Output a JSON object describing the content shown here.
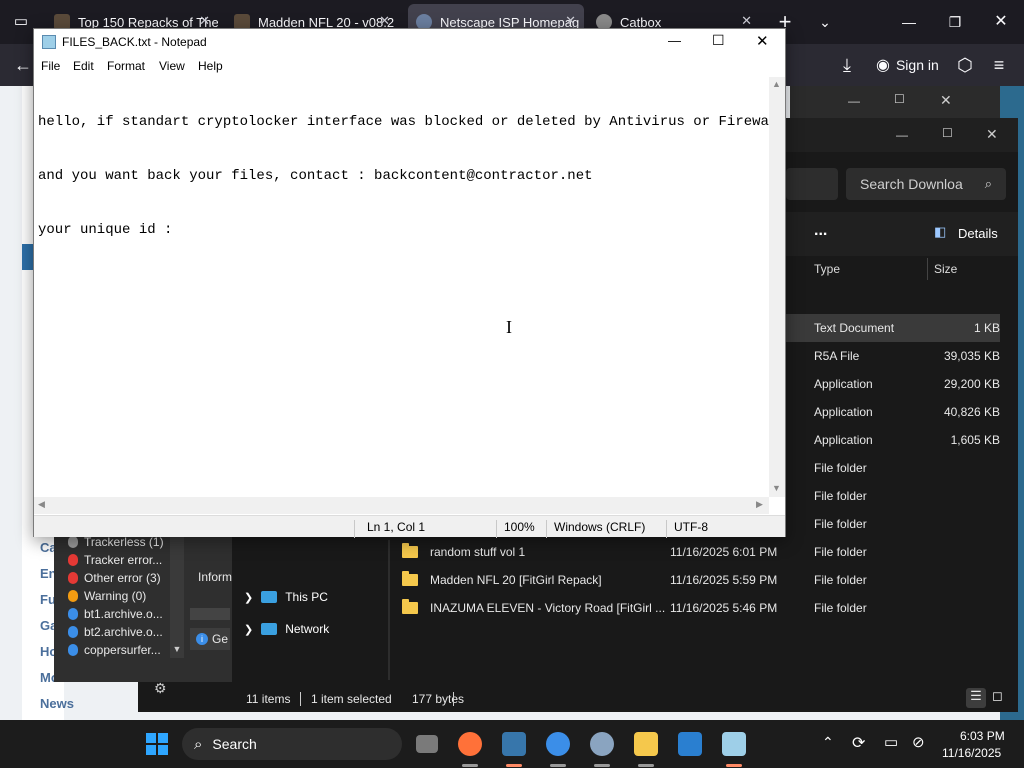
{
  "browser": {
    "tabs": [
      {
        "title": "Top 150 Repacks of The",
        "active": false
      },
      {
        "title": "Madden NFL 20 - v08.2",
        "active": false
      },
      {
        "title": "Netscape ISP Homepag",
        "active": true
      },
      {
        "title": "Catbox",
        "active": false
      }
    ],
    "new_tab": "+",
    "sign_in": "Sign in"
  },
  "website": {
    "side_items": [
      "Ca",
      "En",
      "Fu",
      "Ga",
      "Ho",
      "Mo",
      "News"
    ]
  },
  "notepad": {
    "title": "FILES_BACK.txt - Notepad",
    "menu": [
      "File",
      "Edit",
      "Format",
      "View",
      "Help"
    ],
    "content_lines": [
      "hello, if standart cryptolocker interface was blocked or deleted by Antivirus or Firewall",
      "and you want back your files, contact : backcontent@contractor.net",
      "your unique id :"
    ],
    "status": {
      "position": "Ln 1, Col 1",
      "zoom": "100%",
      "line_ending": "Windows (CRLF)",
      "encoding": "UTF-8"
    }
  },
  "explorer": {
    "search_placeholder": "Search Downloa",
    "more": "...",
    "details_label": "Details",
    "columns": {
      "type": "Type",
      "size": "Size"
    },
    "rows": [
      {
        "type": "Text Document",
        "size": "1 KB",
        "selected": true
      },
      {
        "type": "R5A File",
        "size": "39,035 KB"
      },
      {
        "type": "Application",
        "size": "29,200 KB"
      },
      {
        "type": "Application",
        "size": "40,826 KB"
      },
      {
        "type": "Application",
        "size": "1,605 KB"
      },
      {
        "type": "File folder",
        "size": ""
      },
      {
        "type": "File folder",
        "size": ""
      },
      {
        "type": "File folder",
        "size": ""
      }
    ],
    "folders": [
      {
        "name": "random stuff vol 1",
        "date": "11/16/2025 6:01 PM",
        "type": "File folder"
      },
      {
        "name": "Madden NFL 20 [FitGirl Repack]",
        "date": "11/16/2025 5:59 PM",
        "type": "File folder"
      },
      {
        "name": "INAZUMA ELEVEN - Victory Road [FitGirl ...",
        "date": "11/16/2025 5:46 PM",
        "type": "File folder"
      }
    ],
    "nav": [
      "This PC",
      "Network"
    ],
    "status": {
      "items": "11 items",
      "selected": "1 item selected",
      "bytes": "177 bytes"
    }
  },
  "qbittorrent": {
    "filters": [
      {
        "label": "Trackerless (1)",
        "color": "#9a9a9a"
      },
      {
        "label": "Tracker error...",
        "color": "#e53935"
      },
      {
        "label": "Other error (3)",
        "color": "#e53935"
      },
      {
        "label": "Warning (0)",
        "color": "#f39c12"
      },
      {
        "label": "bt1.archive.o...",
        "color": "#3b8ee8"
      },
      {
        "label": "bt2.archive.o...",
        "color": "#3b8ee8"
      },
      {
        "label": "coppersurfer...",
        "color": "#3b8ee8"
      }
    ],
    "info_label": "Inform",
    "general_label": "Ge"
  },
  "taskbar": {
    "search": "Search",
    "time": "6:03 PM",
    "date": "11/16/2025"
  }
}
